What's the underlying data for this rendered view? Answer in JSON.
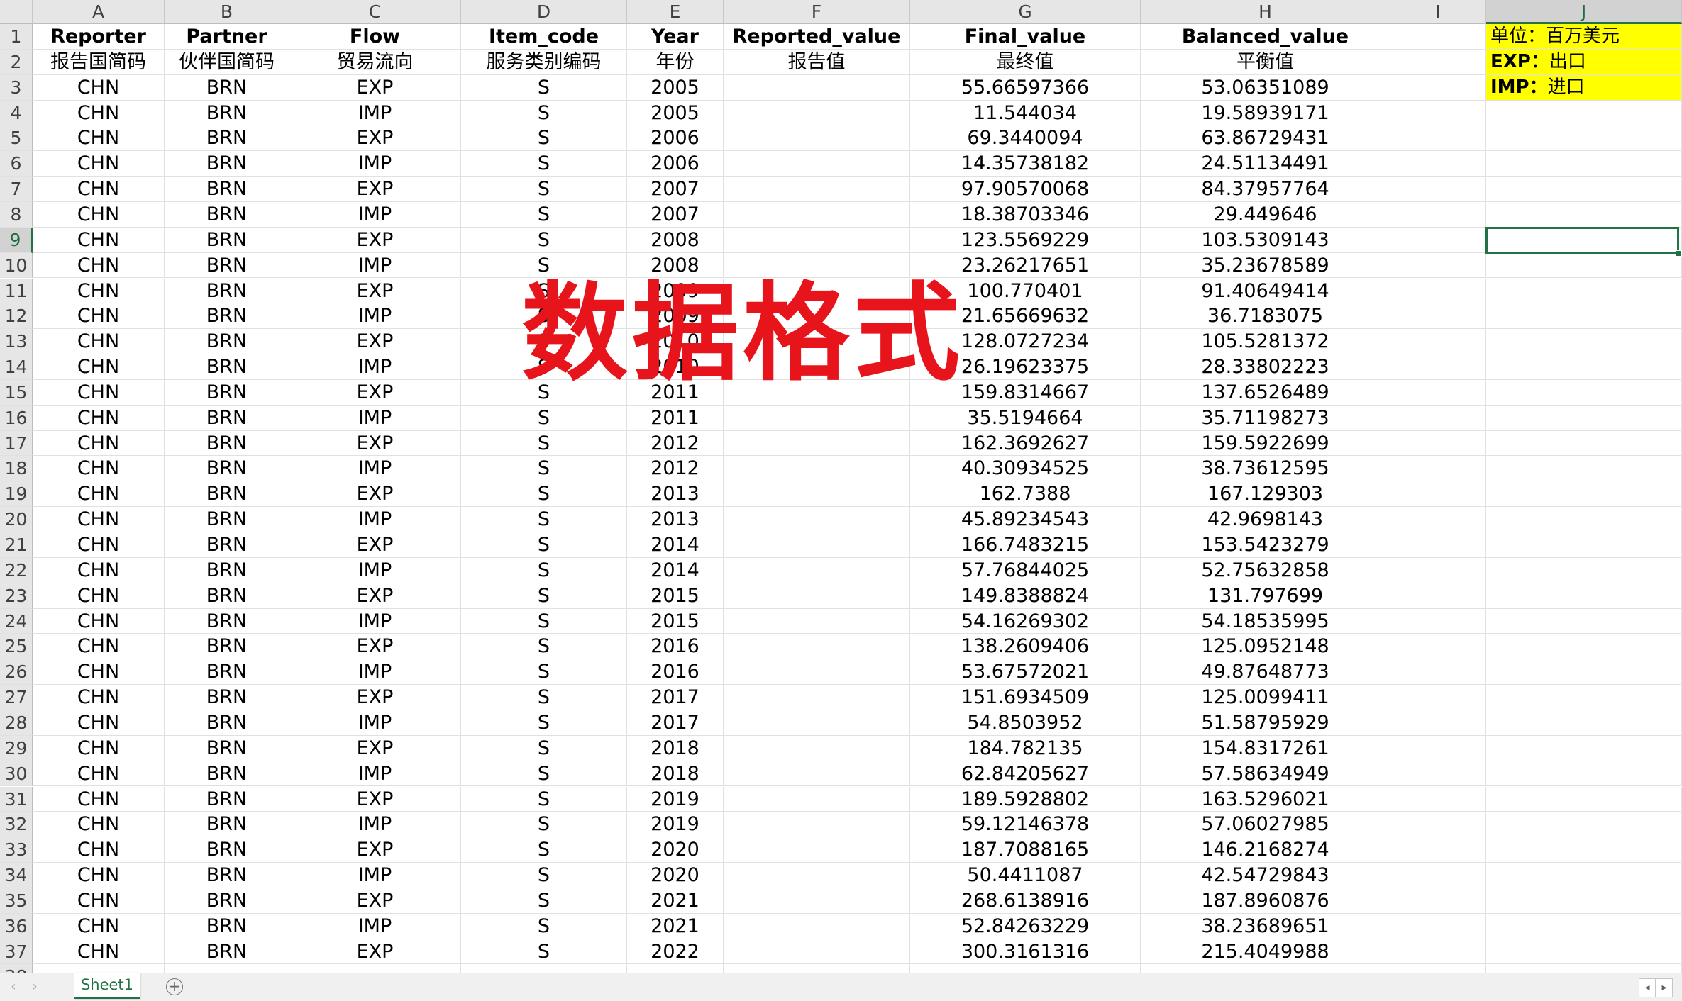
{
  "sheet": {
    "column_letters": [
      "A",
      "B",
      "C",
      "D",
      "E",
      "F",
      "G",
      "H",
      "I",
      "J"
    ],
    "selected_column": "J",
    "selected_row": "9",
    "header_en": [
      "Reporter",
      "Partner",
      "Flow",
      "Item_code",
      "Year",
      "Reported_value",
      "Final_value",
      "Balanced_value"
    ],
    "header_cn": [
      "报告国简码",
      "伙伴国简码",
      "贸易流向",
      "服务类别编码",
      "年份",
      "报告值",
      "最终值",
      "平衡值"
    ],
    "legend": [
      "单位：百万美元",
      "EXP：出口",
      "IMP：进口"
    ],
    "rows": [
      [
        "CHN",
        "BRN",
        "EXP",
        "S",
        "2005",
        "",
        "55.66597366",
        "53.06351089"
      ],
      [
        "CHN",
        "BRN",
        "IMP",
        "S",
        "2005",
        "",
        "11.544034",
        "19.58939171"
      ],
      [
        "CHN",
        "BRN",
        "EXP",
        "S",
        "2006",
        "",
        "69.3440094",
        "63.86729431"
      ],
      [
        "CHN",
        "BRN",
        "IMP",
        "S",
        "2006",
        "",
        "14.35738182",
        "24.51134491"
      ],
      [
        "CHN",
        "BRN",
        "EXP",
        "S",
        "2007",
        "",
        "97.90570068",
        "84.37957764"
      ],
      [
        "CHN",
        "BRN",
        "IMP",
        "S",
        "2007",
        "",
        "18.38703346",
        "29.449646"
      ],
      [
        "CHN",
        "BRN",
        "EXP",
        "S",
        "2008",
        "",
        "123.5569229",
        "103.5309143"
      ],
      [
        "CHN",
        "BRN",
        "IMP",
        "S",
        "2008",
        "",
        "23.26217651",
        "35.23678589"
      ],
      [
        "CHN",
        "BRN",
        "EXP",
        "S",
        "2009",
        "",
        "100.770401",
        "91.40649414"
      ],
      [
        "CHN",
        "BRN",
        "IMP",
        "S",
        "2009",
        "",
        "21.65669632",
        "36.7183075"
      ],
      [
        "CHN",
        "BRN",
        "EXP",
        "S",
        "2010",
        "",
        "128.0727234",
        "105.5281372"
      ],
      [
        "CHN",
        "BRN",
        "IMP",
        "S",
        "2010",
        "",
        "26.19623375",
        "28.33802223"
      ],
      [
        "CHN",
        "BRN",
        "EXP",
        "S",
        "2011",
        "",
        "159.8314667",
        "137.6526489"
      ],
      [
        "CHN",
        "BRN",
        "IMP",
        "S",
        "2011",
        "",
        "35.5194664",
        "35.71198273"
      ],
      [
        "CHN",
        "BRN",
        "EXP",
        "S",
        "2012",
        "",
        "162.3692627",
        "159.5922699"
      ],
      [
        "CHN",
        "BRN",
        "IMP",
        "S",
        "2012",
        "",
        "40.30934525",
        "38.73612595"
      ],
      [
        "CHN",
        "BRN",
        "EXP",
        "S",
        "2013",
        "",
        "162.7388",
        "167.129303"
      ],
      [
        "CHN",
        "BRN",
        "IMP",
        "S",
        "2013",
        "",
        "45.89234543",
        "42.9698143"
      ],
      [
        "CHN",
        "BRN",
        "EXP",
        "S",
        "2014",
        "",
        "166.7483215",
        "153.5423279"
      ],
      [
        "CHN",
        "BRN",
        "IMP",
        "S",
        "2014",
        "",
        "57.76844025",
        "52.75632858"
      ],
      [
        "CHN",
        "BRN",
        "EXP",
        "S",
        "2015",
        "",
        "149.8388824",
        "131.797699"
      ],
      [
        "CHN",
        "BRN",
        "IMP",
        "S",
        "2015",
        "",
        "54.16269302",
        "54.18535995"
      ],
      [
        "CHN",
        "BRN",
        "EXP",
        "S",
        "2016",
        "",
        "138.2609406",
        "125.0952148"
      ],
      [
        "CHN",
        "BRN",
        "IMP",
        "S",
        "2016",
        "",
        "53.67572021",
        "49.87648773"
      ],
      [
        "CHN",
        "BRN",
        "EXP",
        "S",
        "2017",
        "",
        "151.6934509",
        "125.0099411"
      ],
      [
        "CHN",
        "BRN",
        "IMP",
        "S",
        "2017",
        "",
        "54.8503952",
        "51.58795929"
      ],
      [
        "CHN",
        "BRN",
        "EXP",
        "S",
        "2018",
        "",
        "184.782135",
        "154.8317261"
      ],
      [
        "CHN",
        "BRN",
        "IMP",
        "S",
        "2018",
        "",
        "62.84205627",
        "57.58634949"
      ],
      [
        "CHN",
        "BRN",
        "EXP",
        "S",
        "2019",
        "",
        "189.5928802",
        "163.5296021"
      ],
      [
        "CHN",
        "BRN",
        "IMP",
        "S",
        "2019",
        "",
        "59.12146378",
        "57.06027985"
      ],
      [
        "CHN",
        "BRN",
        "EXP",
        "S",
        "2020",
        "",
        "187.7088165",
        "146.2168274"
      ],
      [
        "CHN",
        "BRN",
        "IMP",
        "S",
        "2020",
        "",
        "50.4411087",
        "42.54729843"
      ],
      [
        "CHN",
        "BRN",
        "EXP",
        "S",
        "2021",
        "",
        "268.6138916",
        "187.8960876"
      ],
      [
        "CHN",
        "BRN",
        "IMP",
        "S",
        "2021",
        "",
        "52.84263229",
        "38.23689651"
      ],
      [
        "CHN",
        "BRN",
        "EXP",
        "S",
        "2022",
        "",
        "300.3161316",
        "215.4049988"
      ]
    ]
  },
  "watermark": "数据格式",
  "tabs": {
    "sheet_name": "Sheet1",
    "add_icon": "plus-circle-icon"
  },
  "colors": {
    "accent": "#217346",
    "legend_bg": "#ffff00",
    "watermark": "#e8141c"
  }
}
